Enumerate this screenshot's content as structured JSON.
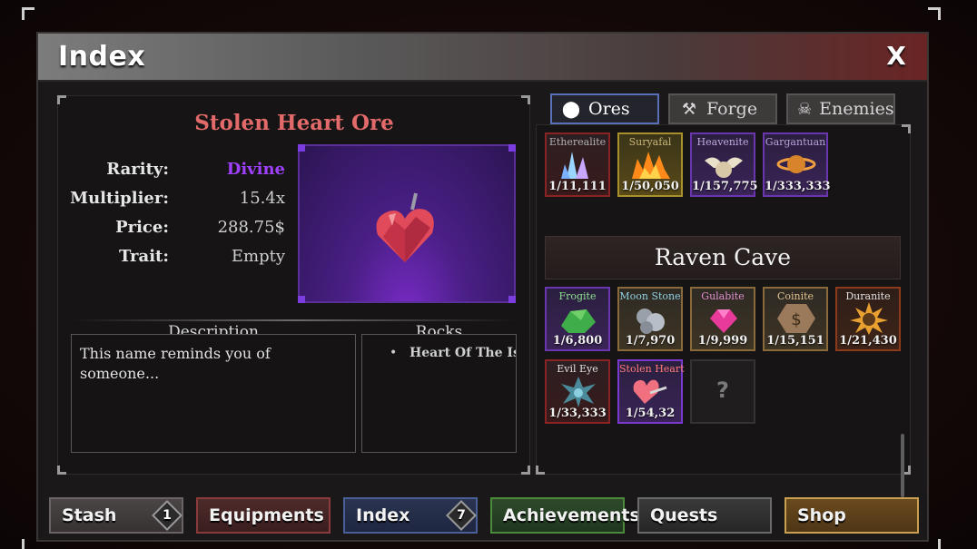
{
  "window": {
    "title": "Index",
    "close_label": "X"
  },
  "ore": {
    "name": "Stolen Heart Ore",
    "rarity_label": "Rarity:",
    "rarity_value": "Divine",
    "rarity_color": "#a040ff",
    "multiplier_label": "Multiplier:",
    "multiplier_value": "15.4x",
    "price_label": "Price:",
    "price_value": "288.75$",
    "trait_label": "Trait:",
    "trait_value": "Empty"
  },
  "description": {
    "title": "Description",
    "text": "This name reminds you of someone..."
  },
  "rocks": {
    "title": "Rocks",
    "items": [
      "Heart Of The Isla"
    ]
  },
  "tabs": [
    {
      "label": "Ores",
      "icon": "ore-icon",
      "active": true
    },
    {
      "label": "Forge",
      "icon": "hammer-icon",
      "active": false
    },
    {
      "label": "Enemies",
      "icon": "skull-icon",
      "active": false
    }
  ],
  "top_row": [
    {
      "name": "Etherealite",
      "value": "1/11,111",
      "name_color": "#b0b0b0"
    },
    {
      "name": "Suryafal",
      "value": "1/50,050",
      "name_color": "#c9b57a"
    },
    {
      "name": "Heavenite",
      "value": "1/157,775",
      "name_color": "#c0a8e0"
    },
    {
      "name": "Gargantuan",
      "value": "1/333,333",
      "name_color": "#b8a0d8"
    }
  ],
  "area": {
    "name": "Raven Cave"
  },
  "cave_ores": [
    {
      "name": "Frogite",
      "value": "1/6,800",
      "name_color": "#8ee08e"
    },
    {
      "name": "Moon Stone",
      "value": "1/7,970",
      "name_color": "#8ed0e0"
    },
    {
      "name": "Gulabite",
      "value": "1/9,999",
      "name_color": "#e08ed0"
    },
    {
      "name": "Coinite",
      "value": "1/15,151",
      "name_color": "#e0c08e"
    },
    {
      "name": "Duranite",
      "value": "1/21,430",
      "name_color": "#e0e0e0"
    },
    {
      "name": "Evil Eye",
      "value": "1/33,333",
      "name_color": "#e0e0e0"
    },
    {
      "name": "Stolen Heart",
      "value": "1/54,32",
      "name_color": "#ff7a7a"
    },
    {
      "name": "",
      "value": "?",
      "name_color": "#888888"
    }
  ],
  "buttons": [
    {
      "label": "Stash",
      "badge": "1"
    },
    {
      "label": "Equipments",
      "badge": ""
    },
    {
      "label": "Index",
      "badge": "7"
    },
    {
      "label": "Achievements",
      "badge": ""
    },
    {
      "label": "Quests",
      "badge": ""
    },
    {
      "label": "Shop",
      "badge": ""
    }
  ]
}
